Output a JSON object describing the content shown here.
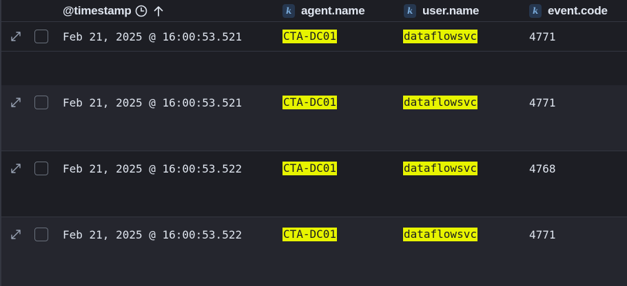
{
  "header": {
    "columns": [
      {
        "label": "@timestamp",
        "type_badge": "",
        "icons": [
          "clock-icon",
          "sort-ascending-icon"
        ]
      },
      {
        "label": "agent.name",
        "type_badge": "k"
      },
      {
        "label": "user.name",
        "type_badge": "k"
      },
      {
        "label": "event.code",
        "type_badge": "k"
      }
    ]
  },
  "highlight_color": "#e7f400",
  "rows": [
    {
      "timestamp": "Feb 21, 2025 @ 16:00:53.521",
      "agent_name": "CTA-DC01",
      "user_name": "dataflowsvc",
      "event_code": "4771"
    },
    {
      "timestamp": "Feb 21, 2025 @ 16:00:53.521",
      "agent_name": "CTA-DC01",
      "user_name": "dataflowsvc",
      "event_code": "4771"
    },
    {
      "timestamp": "Feb 21, 2025 @ 16:00:53.522",
      "agent_name": "CTA-DC01",
      "user_name": "dataflowsvc",
      "event_code": "4768"
    },
    {
      "timestamp": "Feb 21, 2025 @ 16:00:53.522",
      "agent_name": "CTA-DC01",
      "user_name": "dataflowsvc",
      "event_code": "4771"
    }
  ]
}
